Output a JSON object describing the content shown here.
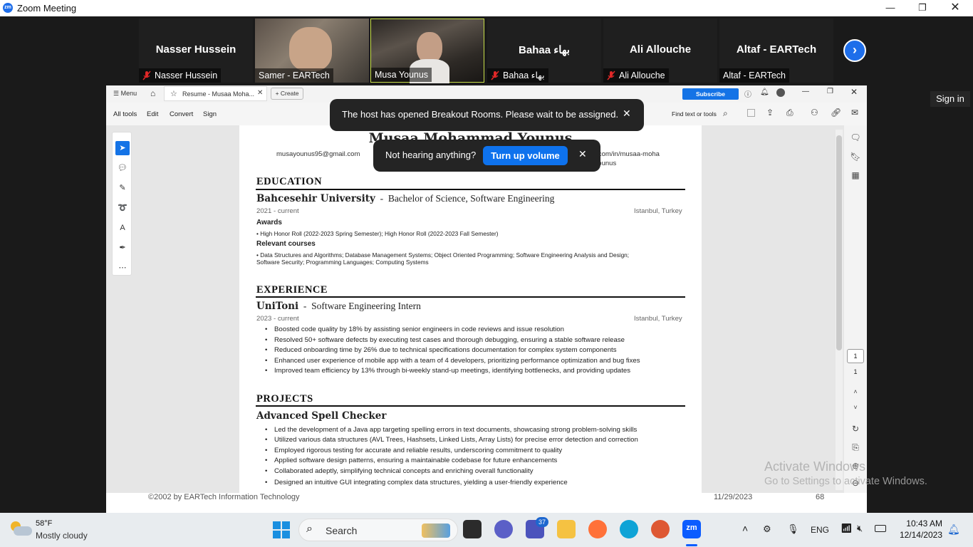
{
  "window": {
    "title": "Zoom Meeting",
    "logo": "zm"
  },
  "participants": [
    {
      "name": "Nasser Hussein",
      "label": "Nasser Hussein",
      "muted": true,
      "video": false
    },
    {
      "name": "",
      "label": "Samer - EARTech",
      "muted": false,
      "video": true
    },
    {
      "name": "",
      "label": "Musa Younus",
      "muted": false,
      "video": true
    },
    {
      "name": "Bahaa بهاء",
      "label": "Bahaa بهاء",
      "muted": true,
      "video": false
    },
    {
      "name": "Ali Allouche",
      "label": "Ali Allouche",
      "muted": true,
      "video": false
    },
    {
      "name": "Altaf - EARTech",
      "label": "Altaf - EARTech",
      "muted": false,
      "video": false
    }
  ],
  "sign_in": "Sign in",
  "acrobat": {
    "menu": "Menu",
    "tab_title": "Resume - Musaa Moha...",
    "create": "Create",
    "subscribe": "Subscribe",
    "toolbar": {
      "all_tools": "All tools",
      "edit": "Edit",
      "convert": "Convert",
      "sign": "Sign",
      "find": "Find text or tools"
    },
    "page_current": "1",
    "page_total": "1"
  },
  "notifications": {
    "breakout": "The host has opened Breakout Rooms. Please wait to be assigned.",
    "volume_text": "Not hearing anything?",
    "volume_button": "Turn up volume"
  },
  "resume": {
    "name": "Musaa Mohammad Younus",
    "email": "musayounus95@gmail.com",
    "linkedin_1": "linkedin.com/in/musaa-moha",
    "linkedin_2": "mmad-younus",
    "education": {
      "title": "EDUCATION",
      "school": "Bahcesehir University",
      "degree": "Bachelor of Science,  Software Engineering",
      "dates": "2021 - current",
      "location": "Istanbul, Turkey",
      "awards_title": "Awards",
      "awards": "• High Honor Roll (2022-2023 Spring Semester);  High Honor Roll (2022-2023 Fall Semester)",
      "courses_title": "Relevant courses",
      "courses_1": "• Data Structures and Algorithms;  Database Management Systems;  Object Oriented Programming;  Software Engineering Analysis and Design;",
      "courses_2": "Software Security;  Programming Languages;  Computing Systems"
    },
    "experience": {
      "title": "EXPERIENCE",
      "company": "UniToni",
      "role": "Software Engineering Intern",
      "dates": "2023 - current",
      "location": "Istanbul, Turkey",
      "bullets": [
        "Boosted code quality by 18% by assisting senior engineers in code reviews and issue resolution",
        "Resolved 50+ software defects by executing test cases and thorough debugging, ensuring a stable software release",
        "Reduced onboarding time by 26% due to technical specifications documentation for complex system components",
        "Enhanced user experience of mobile app with a team of 4 developers, prioritizing performance optimization and bug fixes",
        "Improved team efficiency by 13% through bi-weekly stand-up meetings, identifying bottlenecks, and providing updates"
      ]
    },
    "projects": {
      "title": "PROJECTS",
      "name": "Advanced Spell Checker",
      "bullets": [
        "Led the development of a Java app targeting spelling errors in text documents, showcasing strong problem-solving skills",
        "Utilized various data structures (AVL Trees, Hashsets, Linked Lists, Array Lists) for precise error detection and correction",
        "Employed rigorous testing for accurate and reliable results, underscoring commitment to quality",
        "Applied software design patterns, ensuring a maintainable codebase for future enhancements",
        "Collaborated adeptly, simplifying technical concepts and enriching overall functionality",
        "Designed an intuitive GUI integrating complex data structures, yielding a user-friendly experience"
      ]
    }
  },
  "footer": {
    "copyright": "©2002 by EARTech Information Technology",
    "date": "11/29/2023",
    "page": "68"
  },
  "watermark": {
    "line1": "Activate Windows",
    "line2": "Go to Settings to activate Windows."
  },
  "taskbar": {
    "weather_temp": "58°F",
    "weather_desc": "Mostly cloudy",
    "search": "Search",
    "teams_badge": "37",
    "lang": "ENG",
    "time": "10:43 AM",
    "date": "12/14/2023"
  },
  "colors": {
    "accent": "#1e6eea",
    "acrobat_blue": "#1473e6",
    "mute_red": "#e02828"
  }
}
